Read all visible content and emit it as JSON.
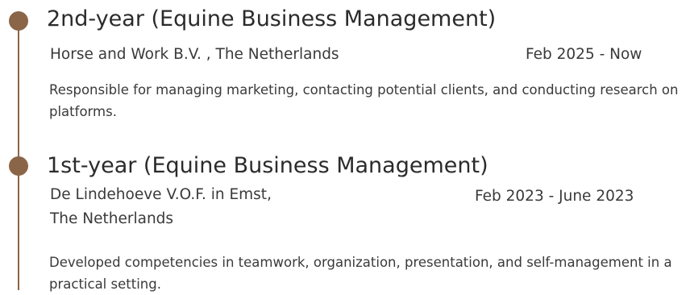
{
  "entries": [
    {
      "title": "2nd-year (Equine Business Management)",
      "organization": "Horse and Work B.V. , The Netherlands",
      "organization_line2": "",
      "period": "Feb 2025 - Now",
      "description": "Responsible for managing marketing, contacting potential clients, and conducting research on platforms."
    },
    {
      "title": "1st-year (Equine Business Management)",
      "organization": "De Lindehoeve V.O.F. in Emst,",
      "organization_line2": "The Netherlands",
      "period": "Feb 2023 - June 2023",
      "description": "Developed competencies in teamwork, organization, presentation, and self-management in a practical setting."
    }
  ],
  "colors": {
    "timeline": "#8b6548",
    "text": "#3a3a3a"
  }
}
